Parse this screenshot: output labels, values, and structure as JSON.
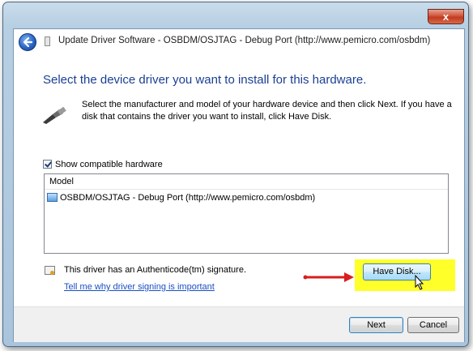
{
  "window": {
    "title": "Update Driver Software - OSBDM/OSJTAG - Debug Port (http://www.pemicro.com/osbdm)",
    "close_label": "x"
  },
  "main": {
    "heading": "Select the device driver you want to install for this hardware.",
    "description": "Select the manufacturer and model of your hardware device and then click Next. If you have a disk that contains the driver you want to install, click Have Disk.",
    "show_compatible": {
      "label": "Show compatible hardware",
      "checked": true
    },
    "list": {
      "header": "Model",
      "items": [
        "OSBDM/OSJTAG - Debug Port (http://www.pemicro.com/osbdm)"
      ]
    },
    "signature_text": "This driver has an Authenticode(tm) signature.",
    "signing_link": "Tell me why driver signing is important",
    "have_disk_label": "Have Disk..."
  },
  "footer": {
    "next_label": "Next",
    "cancel_label": "Cancel"
  },
  "annotation": {
    "highlight_color": "#ffff29",
    "arrow_color": "#d81e1e"
  },
  "icons": [
    "back-arrow-icon",
    "wizard-icon",
    "usb-device-icon",
    "hardware-icon",
    "certificate-icon",
    "mouse-cursor-icon"
  ]
}
